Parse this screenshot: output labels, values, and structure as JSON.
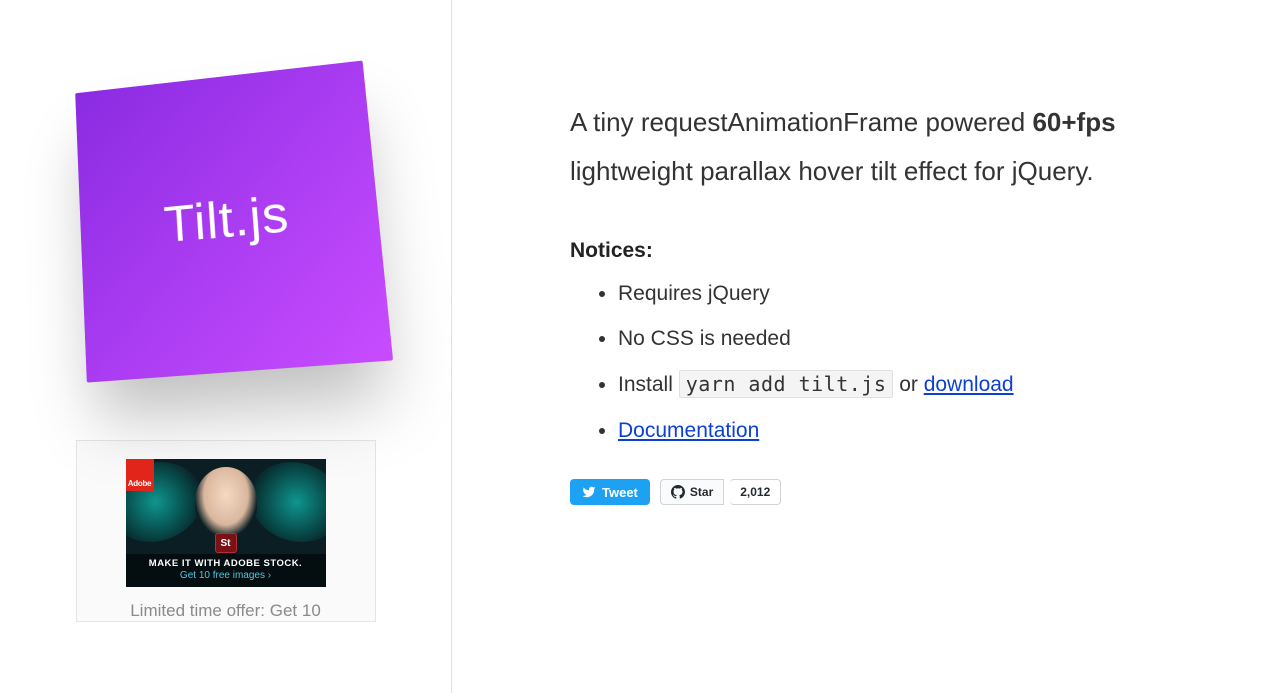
{
  "left": {
    "card_title": "Tilt.js",
    "ad": {
      "adobe_badge": "Adobe",
      "st_badge": "St",
      "headline": "MAKE IT WITH ADOBE STOCK.",
      "subline": "Get 10 free images ›",
      "caption": "Limited time offer: Get 10"
    }
  },
  "right": {
    "tagline_pre": "A tiny requestAnimationFrame powered ",
    "tagline_strong": "60+fps",
    "tagline_post": " lightweight parallax hover tilt effect for jQuery.",
    "notices_header": "Notices:",
    "notices": {
      "item1": "Requires jQuery",
      "item2": "No CSS is needed",
      "item3_pre": "Install ",
      "item3_code": "yarn add tilt.js",
      "item3_mid": " or ",
      "item3_link": "download",
      "item4_link": "Documentation"
    },
    "social": {
      "tweet_label": "Tweet",
      "star_label": "Star",
      "star_count": "2,012"
    }
  }
}
